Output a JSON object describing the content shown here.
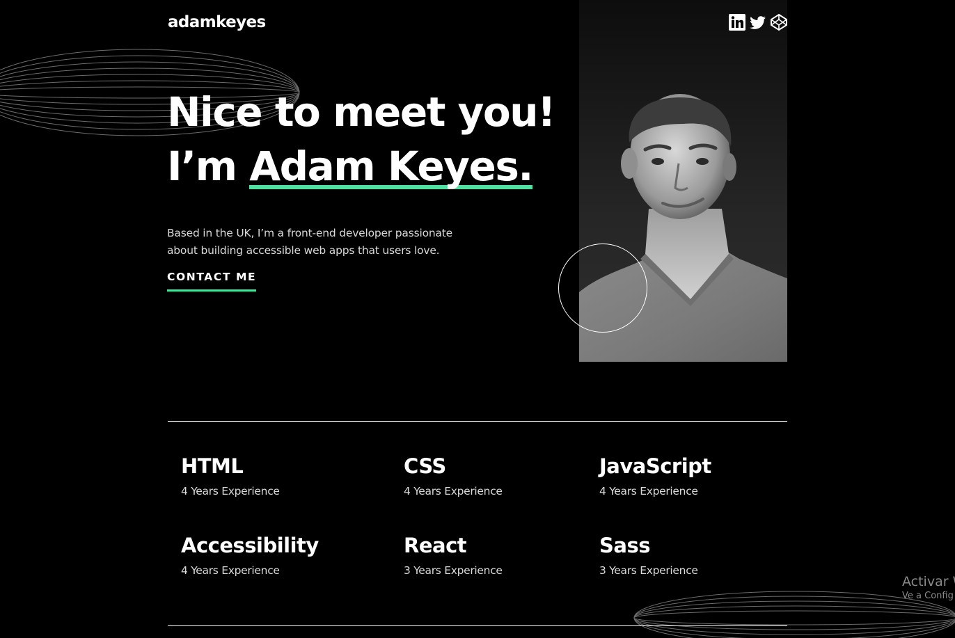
{
  "header": {
    "logo": "adamkeyes",
    "socials": [
      "linkedin-icon",
      "twitter-icon",
      "codepen-icon"
    ]
  },
  "hero": {
    "headline_line1": "Nice to meet you!",
    "headline_prefix": "I’m ",
    "headline_name": "Adam Keyes.",
    "intro": "Based in the UK, I’m a front-end developer passionate about building accessible web apps that users love.",
    "contact_label": "CONTACT ME",
    "accent_color": "#4ee1a0"
  },
  "skills": [
    {
      "name": "HTML",
      "experience": "4 Years Experience"
    },
    {
      "name": "CSS",
      "experience": "4 Years Experience"
    },
    {
      "name": "JavaScript",
      "experience": "4 Years Experience"
    },
    {
      "name": "Accessibility",
      "experience": "4 Years Experience"
    },
    {
      "name": "React",
      "experience": "3 Years Experience"
    },
    {
      "name": "Sass",
      "experience": "3 Years Experience"
    }
  ],
  "watermark": {
    "title": "Activar W",
    "subtitle": "Ve a Config"
  }
}
